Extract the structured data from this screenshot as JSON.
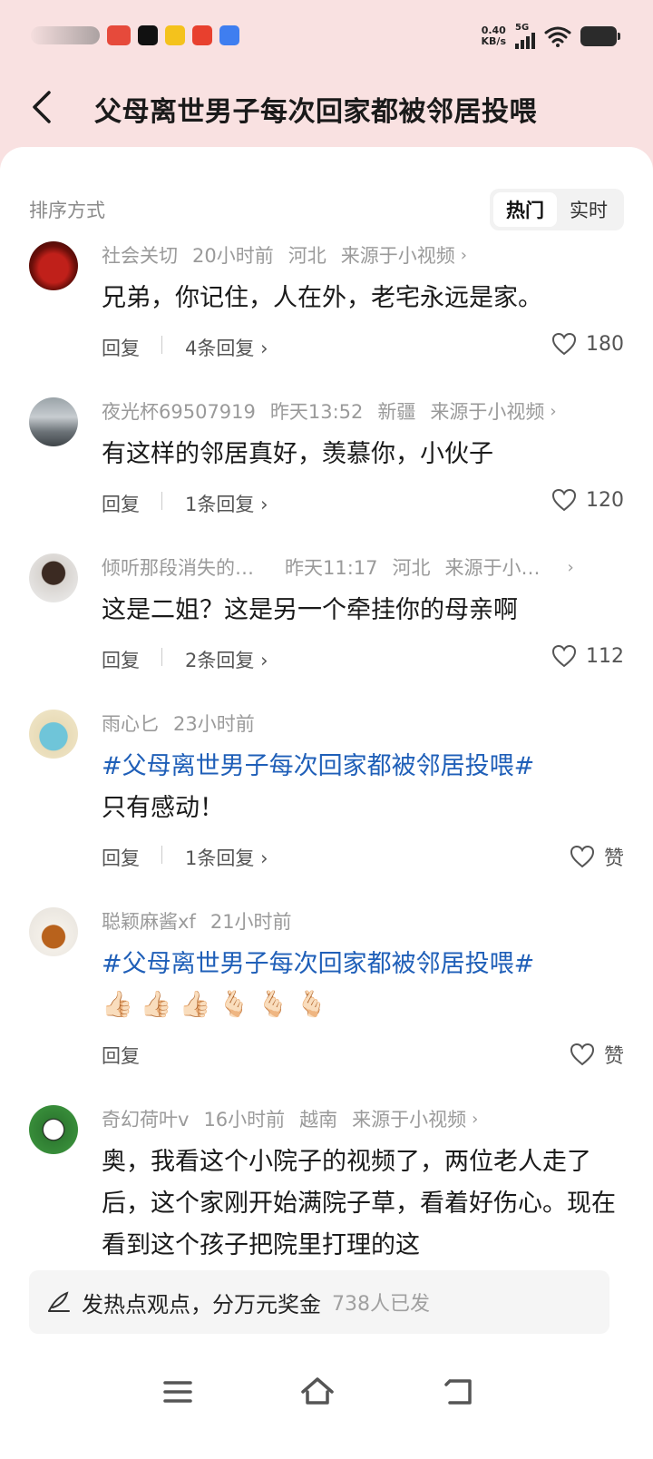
{
  "status": {
    "net_speed_value": "0.40",
    "net_speed_unit": "KB/s",
    "signal": "5G",
    "app_icons": [
      {
        "name": "toutiao-icon",
        "label": "头条"
      },
      {
        "name": "tiktok-icon"
      },
      {
        "name": "yellow-app-icon"
      },
      {
        "name": "taobao-icon",
        "label": "淘"
      },
      {
        "name": "blue-app-icon"
      }
    ]
  },
  "header": {
    "back_icon": "chevron-left-icon",
    "title": "父母离世男子每次回家都被邻居投喂"
  },
  "sort": {
    "label": "排序方式",
    "options": [
      {
        "label": "热门",
        "active": true
      },
      {
        "label": "实时",
        "active": false
      }
    ]
  },
  "comments": [
    {
      "user": "社会关切",
      "time": "20小时前",
      "region": "河北",
      "source": "来源于小视频",
      "body": "兄弟，你记住，人在外，老宅永远是家。",
      "reply_label": "回复",
      "reply_count": "4条回复",
      "likes": "180"
    },
    {
      "user": "夜光杯69507919",
      "time": "昨天13:52",
      "region": "新疆",
      "source": "来源于小视频",
      "body": "有这样的邻居真好，羡慕你，小伙子",
      "reply_label": "回复",
      "reply_count": "1条回复",
      "likes": "120"
    },
    {
      "user": "倾听那段消失的…",
      "time": "昨天11:17",
      "region": "河北",
      "source": "来源于小…",
      "body": "这是二姐？这是另一个牵挂你的母亲啊",
      "reply_label": "回复",
      "reply_count": "2条回复",
      "likes": "112"
    },
    {
      "user": "雨心匕",
      "time": "23小时前",
      "topic": "#父母离世男子每次回家都被邻居投喂#",
      "body": "只有感动！",
      "reply_label": "回复",
      "reply_count": "1条回复",
      "likes": "赞"
    },
    {
      "user": "聪颖麻酱xf",
      "time": "21小时前",
      "topic": "#父母离世男子每次回家都被邻居投喂#",
      "emojis": [
        "👍🏻",
        "👍🏻",
        "👍🏻",
        "🫰🏻",
        "🫰🏻",
        "🫰🏻"
      ],
      "reply_label": "回复",
      "likes": "赞"
    },
    {
      "user": "奇幻荷叶v",
      "time": "16小时前",
      "region": "越南",
      "source": "来源于小视频",
      "body": "奥，我看这个小院子的视频了，两位老人走了后，这个家刚开始满院子草，看着好伤心。现在看到这个孩子把院里打理的这"
    }
  ],
  "post_bar": {
    "icon": "pen-icon",
    "text": "发热点观点，分万元奖金",
    "count": "738人已发"
  },
  "nav": [
    "menu-icon",
    "home-icon",
    "back-icon"
  ],
  "colors": {
    "header_bg": "#f9e1e1",
    "topic_blue": "#1f5fb8",
    "meta_gray": "#9a9a9a"
  }
}
